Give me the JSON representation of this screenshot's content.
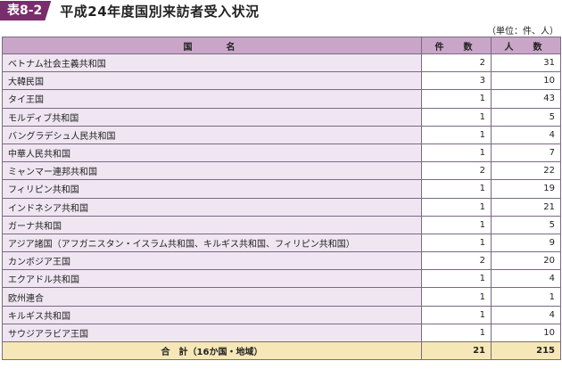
{
  "header": {
    "badge": "表8-2",
    "title": "平成24年度国別来訪者受入状況",
    "unit": "（単位：件、人）"
  },
  "table": {
    "columns": [
      "国　　名",
      "件　数",
      "人　数"
    ],
    "rows": [
      {
        "country": "ベトナム社会主義共和国",
        "cases": "2",
        "people": "31"
      },
      {
        "country": "大韓民国",
        "cases": "3",
        "people": "10"
      },
      {
        "country": "タイ王国",
        "cases": "1",
        "people": "43"
      },
      {
        "country": "モルディブ共和国",
        "cases": "1",
        "people": "5"
      },
      {
        "country": "バングラデシュ人民共和国",
        "cases": "1",
        "people": "4"
      },
      {
        "country": "中華人民共和国",
        "cases": "1",
        "people": "7"
      },
      {
        "country": "ミャンマー連邦共和国",
        "cases": "2",
        "people": "22"
      },
      {
        "country": "フィリピン共和国",
        "cases": "1",
        "people": "19"
      },
      {
        "country": "インドネシア共和国",
        "cases": "1",
        "people": "21"
      },
      {
        "country": "ガーナ共和国",
        "cases": "1",
        "people": "5"
      },
      {
        "country": "アジア諸国（アフガニスタン・イスラム共和国、キルギス共和国、フィリピン共和国）",
        "cases": "1",
        "people": "9"
      },
      {
        "country": "カンボジア王国",
        "cases": "2",
        "people": "20"
      },
      {
        "country": "エクアドル共和国",
        "cases": "1",
        "people": "4"
      },
      {
        "country": "欧州連合",
        "cases": "1",
        "people": "1"
      },
      {
        "country": "キルギス共和国",
        "cases": "1",
        "people": "4"
      },
      {
        "country": "サウジアラビア王国",
        "cases": "1",
        "people": "10"
      }
    ],
    "total": {
      "label": "合　計（16か国・地域）",
      "cases": "21",
      "people": "215"
    }
  }
}
